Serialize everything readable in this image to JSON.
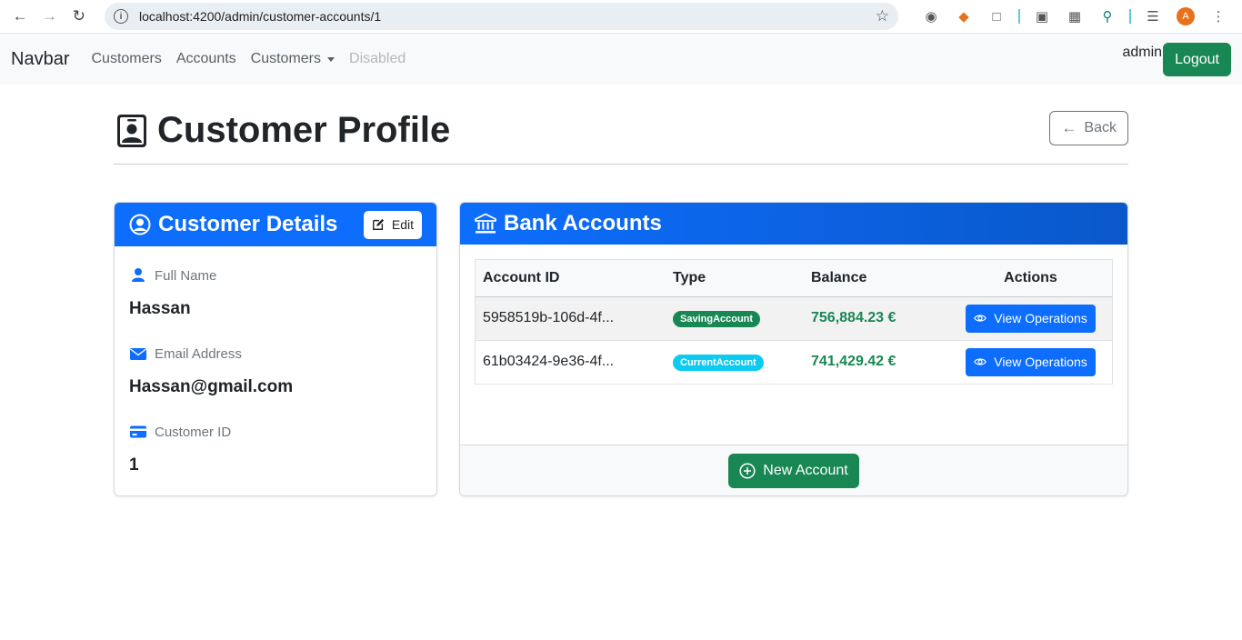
{
  "browser": {
    "url": "localhost:4200/admin/customer-accounts/1",
    "avatar_letter": "A"
  },
  "navbar": {
    "brand": "Navbar",
    "links": [
      "Customers",
      "Accounts",
      "Customers",
      "Disabled"
    ],
    "user": "admin",
    "logout_label": "Logout"
  },
  "page": {
    "title": "Customer Profile",
    "back_label": "Back"
  },
  "details_card": {
    "title": "Customer Details",
    "edit_label": "Edit",
    "fields": [
      {
        "label": "Full Name",
        "value": "Hassan",
        "icon": "person-icon"
      },
      {
        "label": "Email Address",
        "value": "Hassan@gmail.com",
        "icon": "envelope-icon"
      },
      {
        "label": "Customer ID",
        "value": "1",
        "icon": "credit-card-icon"
      }
    ]
  },
  "accounts_card": {
    "title": "Bank Accounts",
    "columns": [
      "Account ID",
      "Type",
      "Balance",
      "Actions"
    ],
    "rows": [
      {
        "id": "5958519b-106d-4f...",
        "type": "SavingAccount",
        "type_color": "#198754",
        "balance": "756,884.23 €",
        "action": "View Operations"
      },
      {
        "id": "61b03424-9e36-4f...",
        "type": "CurrentAccount",
        "type_color": "#0dcaf0",
        "balance": "741,429.42 €",
        "action": "View Operations"
      }
    ],
    "new_account_label": "New Account"
  },
  "colors": {
    "primary": "#0d6efd",
    "success": "#198754",
    "info": "#0dcaf0"
  }
}
